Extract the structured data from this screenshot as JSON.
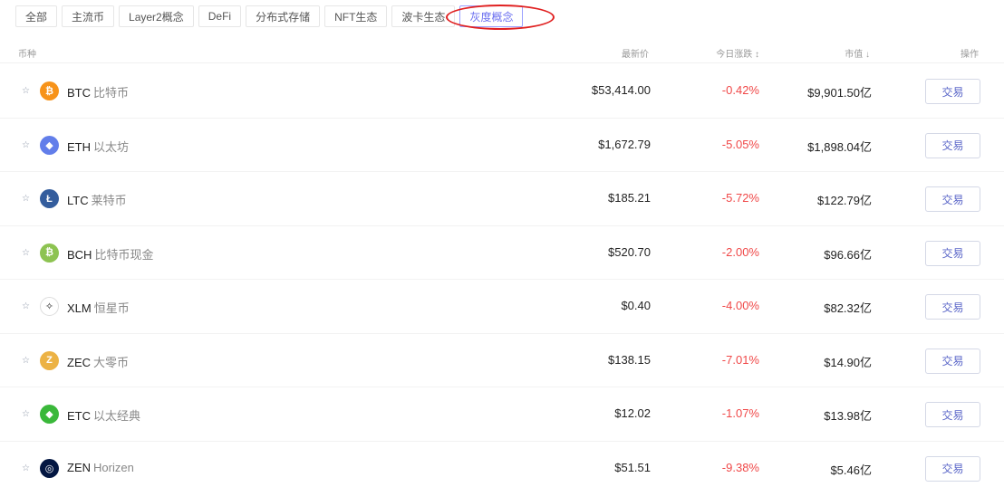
{
  "tabs": [
    {
      "label": "全部",
      "active": false
    },
    {
      "label": "主流币",
      "active": false
    },
    {
      "label": "Layer2概念",
      "active": false
    },
    {
      "label": "DeFi",
      "active": false
    },
    {
      "label": "分布式存储",
      "active": false
    },
    {
      "label": "NFT生态",
      "active": false
    },
    {
      "label": "波卡生态",
      "active": false
    },
    {
      "label": "灰度概念",
      "active": true
    }
  ],
  "header": {
    "name": "币种",
    "price": "最新价",
    "change": "今日涨跌 ↕",
    "cap": "市值 ↓",
    "op": "操作"
  },
  "rows": [
    {
      "symbol": "BTC",
      "cn": "比特币",
      "price": "$53,414.00",
      "change": "-0.42%",
      "cap": "$9,901.50亿",
      "icon": "bitcoin-icon",
      "color": "#f7931a",
      "glyph": "₿",
      "trade": "交易"
    },
    {
      "symbol": "ETH",
      "cn": "以太坊",
      "price": "$1,672.79",
      "change": "-5.05%",
      "cap": "$1,898.04亿",
      "icon": "ethereum-icon",
      "color": "#627eea",
      "glyph": "◆",
      "trade": "交易"
    },
    {
      "symbol": "LTC",
      "cn": "莱特币",
      "price": "$185.21",
      "change": "-5.72%",
      "cap": "$122.79亿",
      "icon": "litecoin-icon",
      "color": "#345d9d",
      "glyph": "Ł",
      "trade": "交易"
    },
    {
      "symbol": "BCH",
      "cn": "比特币现金",
      "price": "$520.70",
      "change": "-2.00%",
      "cap": "$96.66亿",
      "icon": "bitcoin-cash-icon",
      "color": "#8dc351",
      "glyph": "₿",
      "trade": "交易"
    },
    {
      "symbol": "XLM",
      "cn": "恒星币",
      "price": "$0.40",
      "change": "-4.00%",
      "cap": "$82.32亿",
      "icon": "stellar-icon",
      "color": "#ffffff",
      "glyph": "✧",
      "trade": "交易"
    },
    {
      "symbol": "ZEC",
      "cn": "大零币",
      "price": "$138.15",
      "change": "-7.01%",
      "cap": "$14.90亿",
      "icon": "zcash-icon",
      "color": "#ecb244",
      "glyph": "Z",
      "trade": "交易"
    },
    {
      "symbol": "ETC",
      "cn": "以太经典",
      "price": "$12.02",
      "change": "-1.07%",
      "cap": "$13.98亿",
      "icon": "ethereum-classic-icon",
      "color": "#3ab83a",
      "glyph": "◆",
      "trade": "交易"
    },
    {
      "symbol": "ZEN",
      "cn": "Horizen",
      "price": "$51.51",
      "change": "-9.38%",
      "cap": "$5.46亿",
      "icon": "horizen-icon",
      "color": "#041742",
      "glyph": "◎",
      "trade": "交易"
    }
  ]
}
